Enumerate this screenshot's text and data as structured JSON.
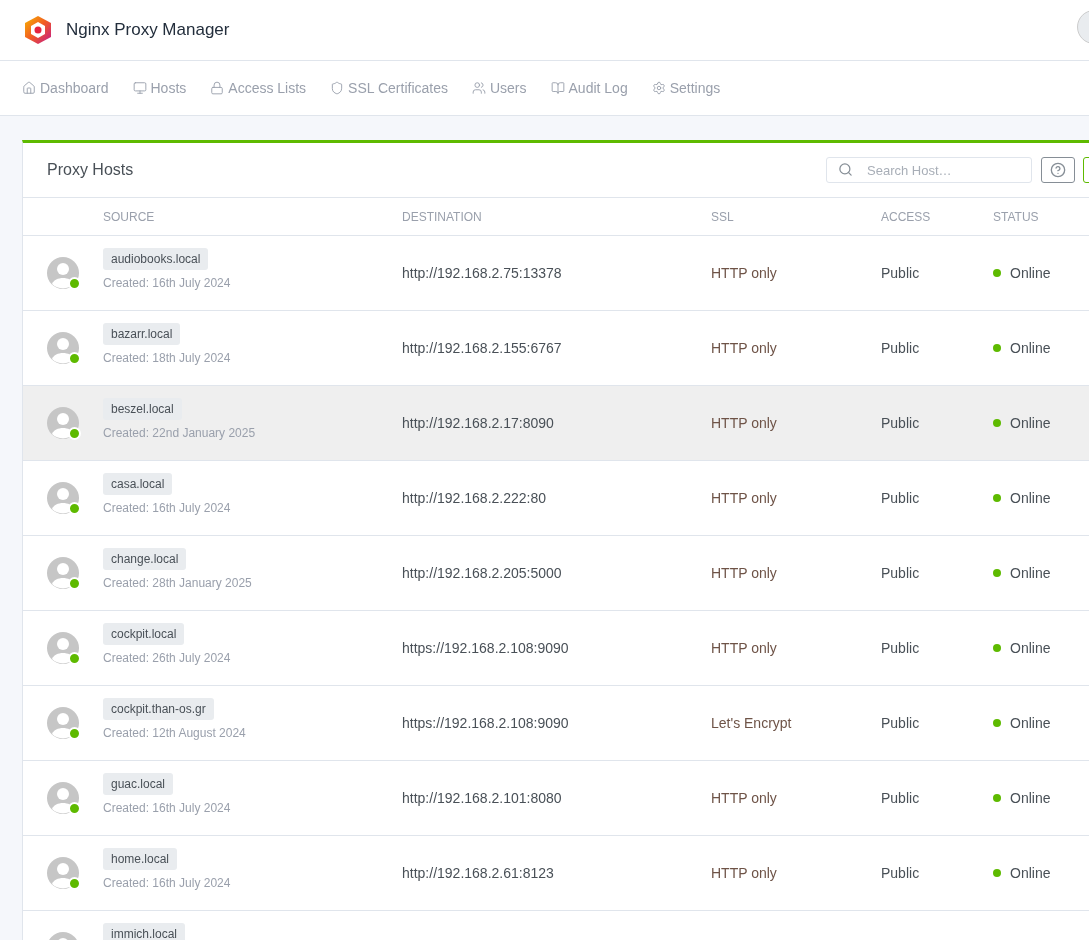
{
  "app": {
    "title": "Nginx Proxy Manager"
  },
  "nav": [
    {
      "label": "Dashboard"
    },
    {
      "label": "Hosts"
    },
    {
      "label": "Access Lists"
    },
    {
      "label": "SSL Certificates"
    },
    {
      "label": "Users"
    },
    {
      "label": "Audit Log"
    },
    {
      "label": "Settings"
    }
  ],
  "card": {
    "title": "Proxy Hosts",
    "search": {
      "placeholder": "Search Host…"
    }
  },
  "table": {
    "columns": [
      "SOURCE",
      "DESTINATION",
      "SSL",
      "ACCESS",
      "STATUS"
    ],
    "rows": [
      {
        "source": "audiobooks.local",
        "created": "Created: 16th July 2024",
        "destination": "http://192.168.2.75:13378",
        "ssl": "HTTP only",
        "access": "Public",
        "status": "Online",
        "online": true,
        "highlighted": false
      },
      {
        "source": "bazarr.local",
        "created": "Created: 18th July 2024",
        "destination": "http://192.168.2.155:6767",
        "ssl": "HTTP only",
        "access": "Public",
        "status": "Online",
        "online": true,
        "highlighted": false
      },
      {
        "source": "beszel.local",
        "created": "Created: 22nd January 2025",
        "destination": "http://192.168.2.17:8090",
        "ssl": "HTTP only",
        "access": "Public",
        "status": "Online",
        "online": true,
        "highlighted": true
      },
      {
        "source": "casa.local",
        "created": "Created: 16th July 2024",
        "destination": "http://192.168.2.222:80",
        "ssl": "HTTP only",
        "access": "Public",
        "status": "Online",
        "online": true,
        "highlighted": false
      },
      {
        "source": "change.local",
        "created": "Created: 28th January 2025",
        "destination": "http://192.168.2.205:5000",
        "ssl": "HTTP only",
        "access": "Public",
        "status": "Online",
        "online": true,
        "highlighted": false
      },
      {
        "source": "cockpit.local",
        "created": "Created: 26th July 2024",
        "destination": "https://192.168.2.108:9090",
        "ssl": "HTTP only",
        "access": "Public",
        "status": "Online",
        "online": true,
        "highlighted": false
      },
      {
        "source": "cockpit.than-os.gr",
        "created": "Created: 12th August 2024",
        "destination": "https://192.168.2.108:9090",
        "ssl": "Let's Encrypt",
        "access": "Public",
        "status": "Online",
        "online": true,
        "highlighted": false
      },
      {
        "source": "guac.local",
        "created": "Created: 16th July 2024",
        "destination": "http://192.168.2.101:8080",
        "ssl": "HTTP only",
        "access": "Public",
        "status": "Online",
        "online": true,
        "highlighted": false
      },
      {
        "source": "home.local",
        "created": "Created: 16th July 2024",
        "destination": "http://192.168.2.61:8123",
        "ssl": "HTTP only",
        "access": "Public",
        "status": "Online",
        "online": true,
        "highlighted": false
      },
      {
        "source": "immich.local"
      }
    ]
  }
}
